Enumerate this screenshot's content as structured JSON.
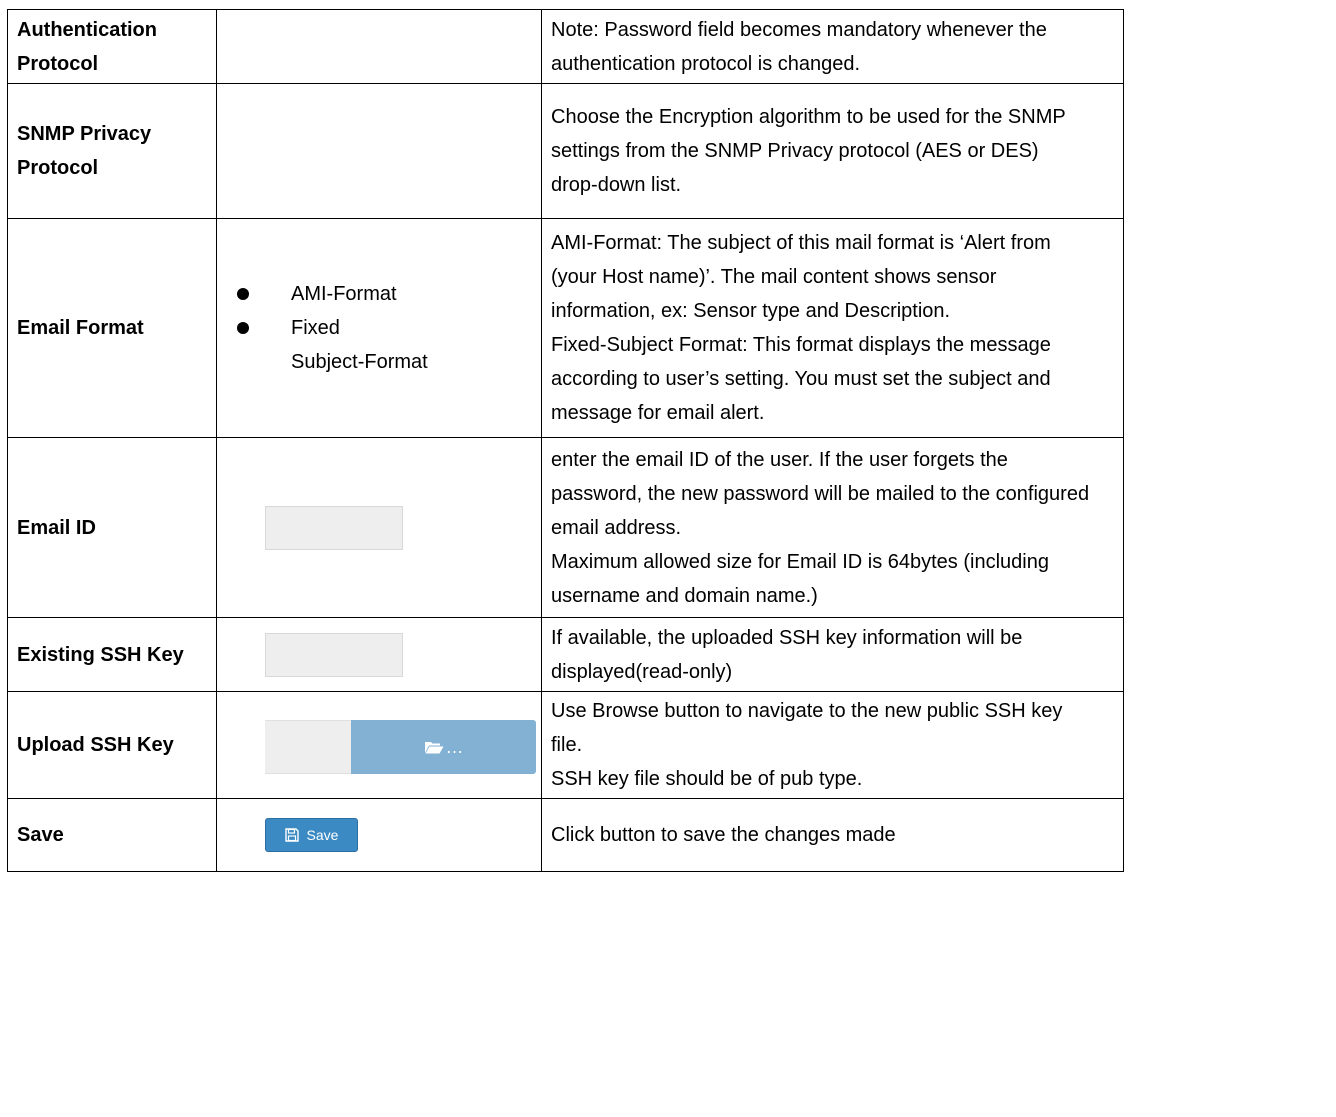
{
  "rows": {
    "auth": {
      "label": [
        "Authentication",
        "Protocol"
      ],
      "desc": [
        "Note: Password field becomes mandatory whenever the",
        "authentication protocol is changed."
      ]
    },
    "snmp": {
      "label": [
        "SNMP Privacy",
        "Protocol"
      ],
      "desc": [
        "Choose the Encryption algorithm to be used for the SNMP",
        "settings from the SNMP Privacy protocol (AES or DES)",
        "drop-down list."
      ]
    },
    "email_format": {
      "label": "Email Format",
      "options": [
        "AMI-Format",
        "Fixed",
        "Subject-Format"
      ],
      "desc": [
        "AMI-Format: The subject of this mail format is ‘Alert from",
        "(your Host name)’. The mail content shows sensor",
        "information, ex: Sensor type and Description.",
        "Fixed-Subject Format: This format displays the message",
        "according to user’s setting. You must set the subject and",
        "message for email alert."
      ]
    },
    "email_id": {
      "label": "Email ID",
      "value": "",
      "desc": [
        "enter the email ID of the user. If the user forgets the",
        "password, the new password will be mailed to the configured",
        "email address.",
        "Maximum allowed size for Email ID is 64bytes (including",
        "username and domain name.)"
      ]
    },
    "existing_ssh": {
      "label": "Existing SSH Key",
      "value": "",
      "desc": [
        "If available, the uploaded SSH key information will be",
        "displayed(read-only)"
      ]
    },
    "upload_ssh": {
      "label": "Upload SSH Key",
      "button_text": "…",
      "desc": [
        "Use Browse button to navigate to the new public SSH key",
        "file.",
        "SSH key file should be of pub type."
      ]
    },
    "save": {
      "label": "Save",
      "button_label": "Save",
      "desc": "Click button to save the changes made"
    }
  },
  "colors": {
    "browse_button": "#82b1d3",
    "save_button": "#3b8ac4",
    "field_bg": "#eeeeee"
  },
  "icons": {
    "browse": "folder-open-icon",
    "save": "floppy-disk-icon",
    "bullet": "bullet-dot"
  }
}
